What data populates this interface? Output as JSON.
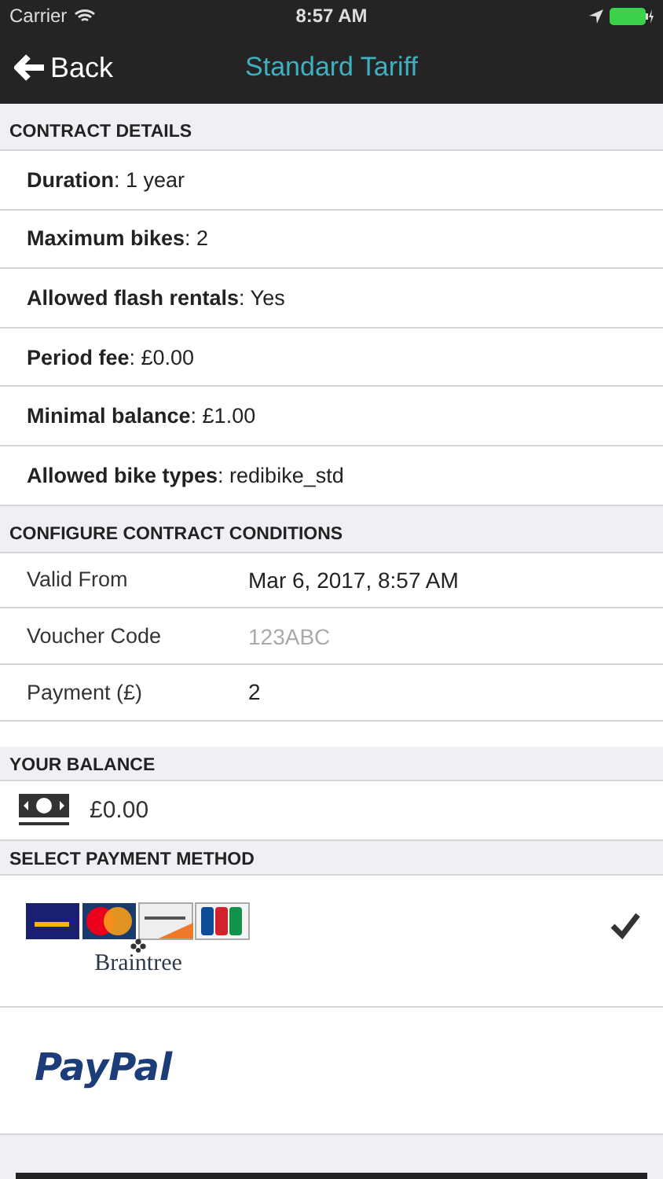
{
  "status_bar": {
    "carrier": "Carrier",
    "time": "8:57 AM"
  },
  "nav": {
    "back": "Back",
    "title": "Standard Tariff"
  },
  "contract_details": {
    "header": "CONTRACT DETAILS",
    "rows": [
      {
        "text": "**Duration**: 1 year"
      },
      {
        "text": "**Maximum bikes**: 2"
      },
      {
        "text": "**Allowed flash rentals**: Yes"
      },
      {
        "text": "**Period fee**: £0.00"
      },
      {
        "text": "**Minimal balance**: £1.00"
      },
      {
        "text": "**Allowed bike types**: redibike_std"
      }
    ]
  },
  "conditions": {
    "header": "CONFIGURE CONTRACT CONDITIONS",
    "rows": [
      {
        "label": "Valid From",
        "value": "Mar 6, 2017, 8:57 AM"
      },
      {
        "label": "Voucher Code",
        "placeholder": "123ABC"
      },
      {
        "label": "Payment (£)",
        "value": "2"
      }
    ]
  },
  "balance": {
    "header": "YOUR BALANCE",
    "amount": "£0.00"
  },
  "payment": {
    "header": "SELECT PAYMENT METHOD",
    "methods": [
      {
        "kind": "braintree",
        "name": "Braintree",
        "selected": true
      },
      {
        "kind": "paypal",
        "name": "PayPal",
        "selected": false
      }
    ]
  }
}
